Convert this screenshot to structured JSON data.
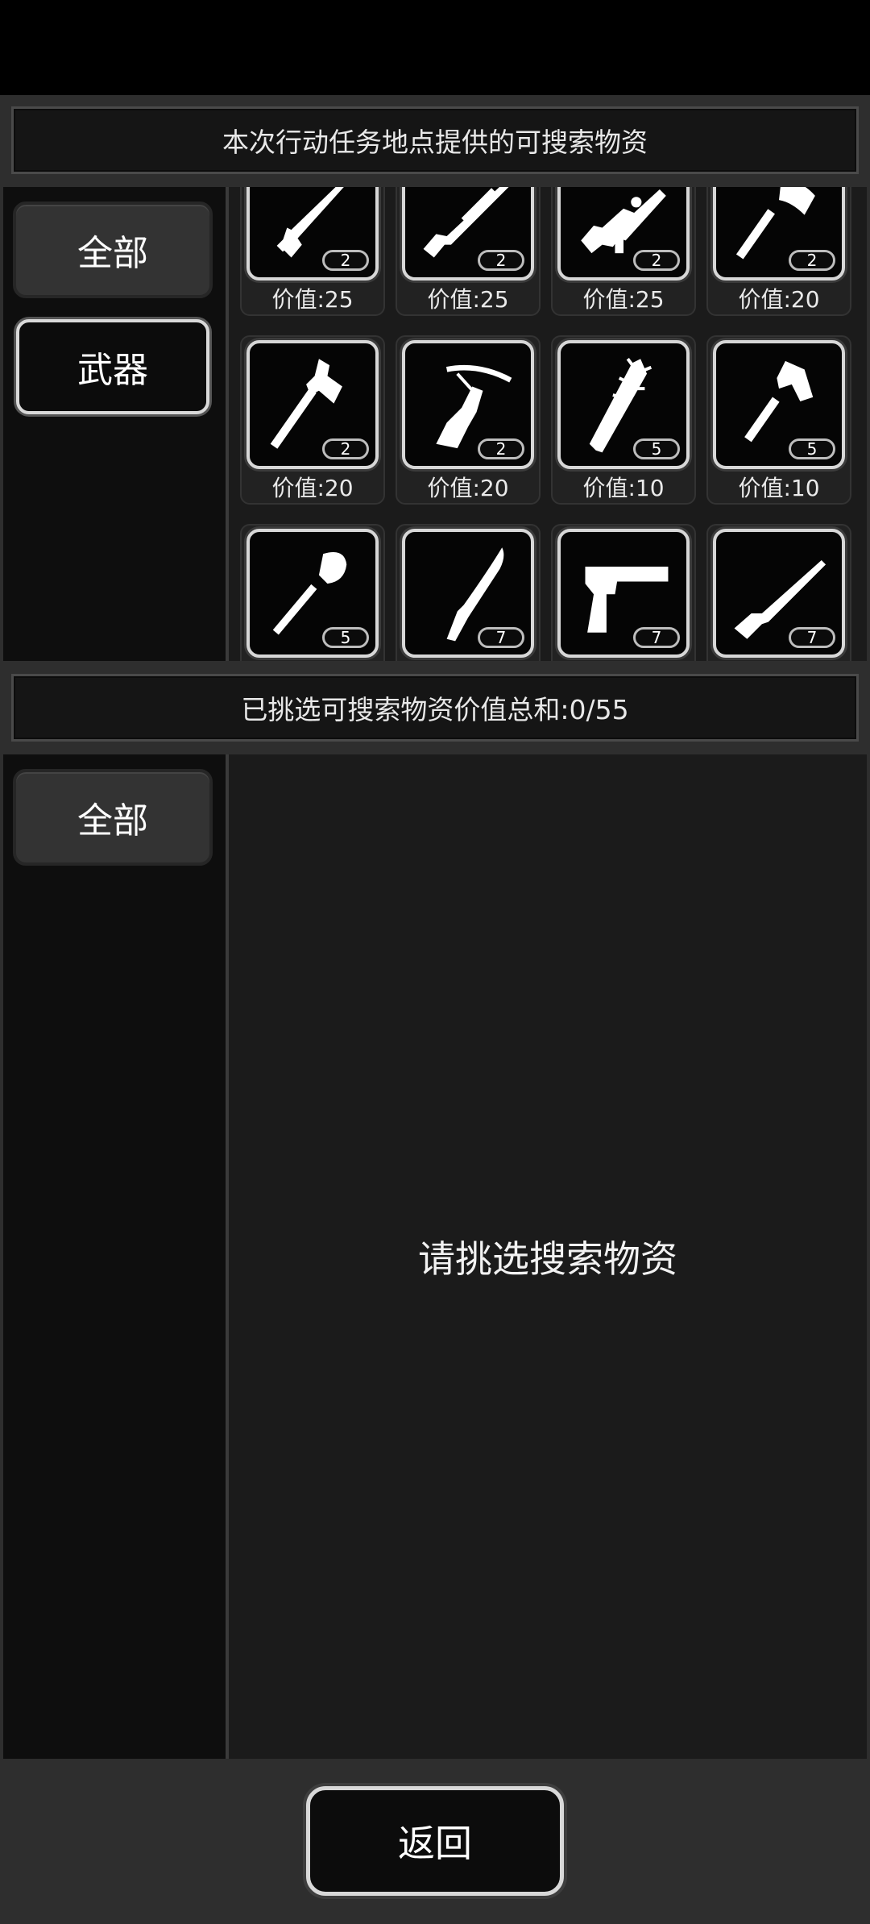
{
  "header": {
    "title": "本次行动任务地点提供的可搜索物资"
  },
  "top_panel": {
    "tabs": [
      {
        "label": "全部",
        "active": false
      },
      {
        "label": "武器",
        "active": true
      }
    ],
    "items": [
      {
        "icon": "machete-icon",
        "qty": "2",
        "price": "价值:25"
      },
      {
        "icon": "shotgun-icon",
        "qty": "2",
        "price": "价值:25"
      },
      {
        "icon": "assault-rifle-icon",
        "qty": "2",
        "price": "价值:25"
      },
      {
        "icon": "axe-icon",
        "qty": "2",
        "price": "价值:20"
      },
      {
        "icon": "fire-axe-icon",
        "qty": "2",
        "price": "价值:20"
      },
      {
        "icon": "crossbow-icon",
        "qty": "2",
        "price": "价值:20"
      },
      {
        "icon": "spiked-bat-icon",
        "qty": "5",
        "price": "价值:10"
      },
      {
        "icon": "hatchet-icon",
        "qty": "5",
        "price": "价值:10"
      },
      {
        "icon": "shovel-icon",
        "qty": "5",
        "price": ""
      },
      {
        "icon": "curved-blade-icon",
        "qty": "7",
        "price": ""
      },
      {
        "icon": "pistol-icon",
        "qty": "7",
        "price": ""
      },
      {
        "icon": "rifle-icon",
        "qty": "7",
        "price": ""
      }
    ]
  },
  "summary": {
    "text": "已挑选可搜索物资价值总和:0/55"
  },
  "bottom_panel": {
    "tabs": [
      {
        "label": "全部"
      }
    ],
    "empty_text": "请挑选搜索物资"
  },
  "footer": {
    "back_label": "返回"
  }
}
